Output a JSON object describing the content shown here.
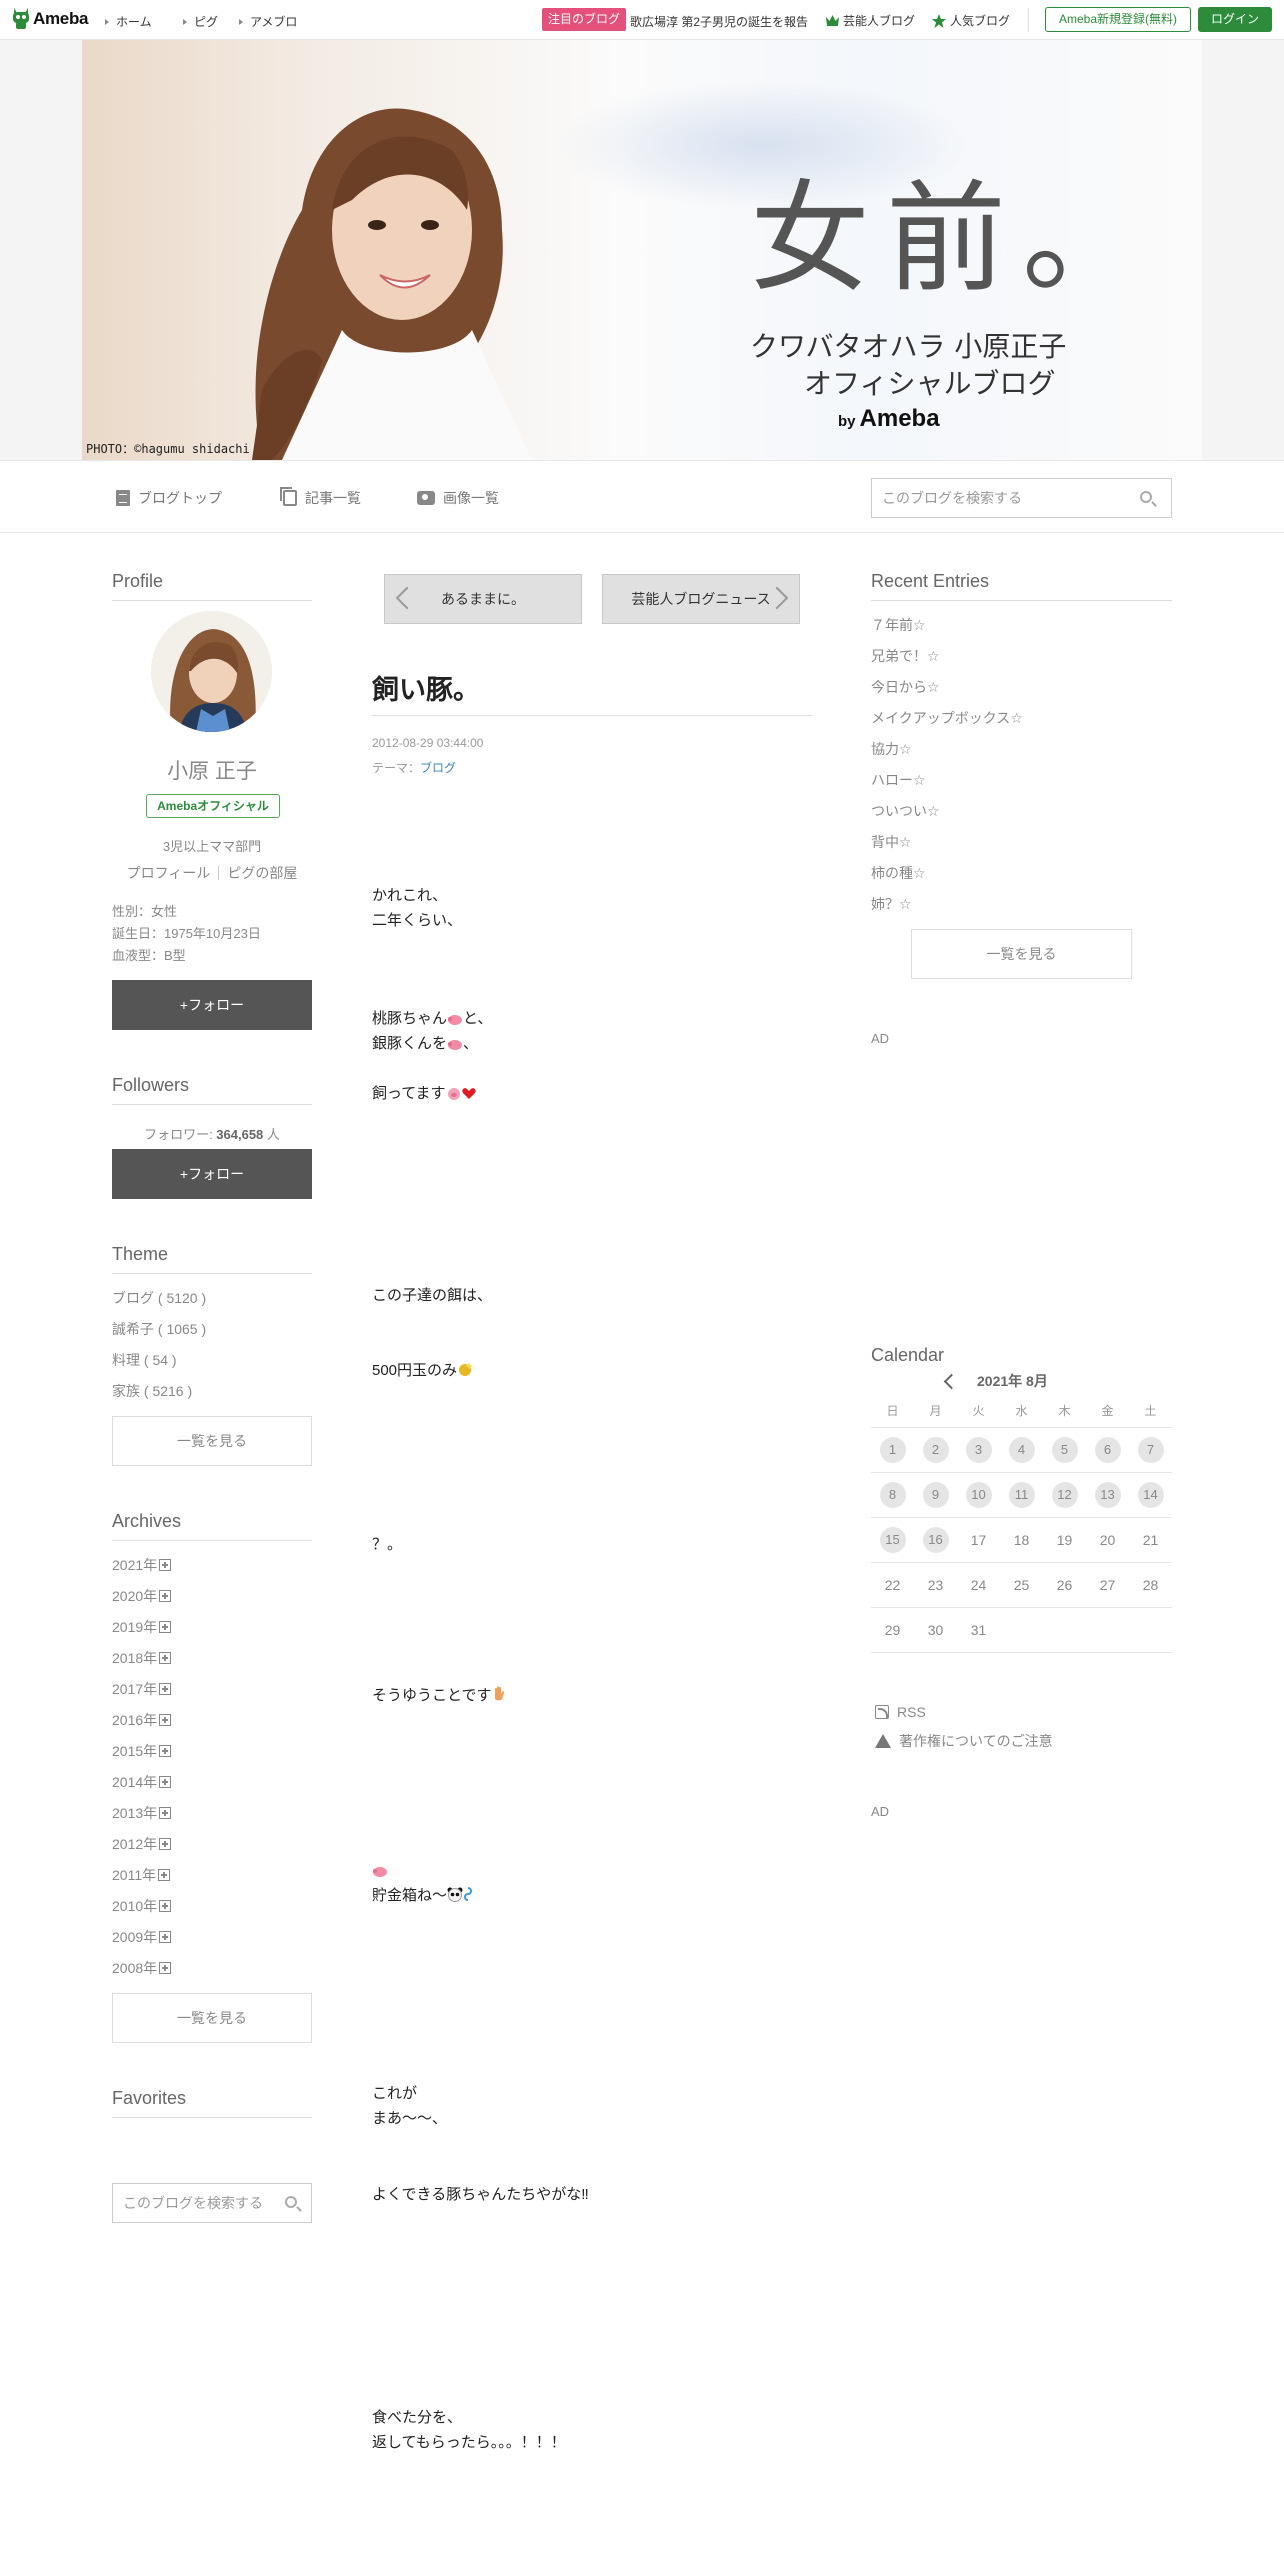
{
  "global_nav": {
    "logo_text": "Ameba",
    "links": [
      "ホーム",
      "ピグ",
      "アメブロ"
    ],
    "pickup_badge": "注目のブログ",
    "pickup_text": "歌広場淳 第2子男児の誕生を報告",
    "rank_links": [
      "芸能人ブログ",
      "人気ブログ"
    ],
    "register_label": "Ameba新規登録(無料)",
    "login_label": "ログイン"
  },
  "banner": {
    "title": "女前。",
    "subtitle_1": "クワバタオハラ 小原正子",
    "subtitle_2": "オフィシャルブログ",
    "by_prefix": "by",
    "by_brand": "Ameba",
    "credit": "PHOTO：©hagumu shidachi"
  },
  "blog_nav": {
    "items": [
      "ブログトップ",
      "記事一覧",
      "画像一覧"
    ],
    "search_placeholder": "このブログを検索する"
  },
  "profile": {
    "heading": "Profile",
    "name": "小原 正子",
    "badge": "Amebaオフィシャル",
    "tagline": "3児以上ママ部門",
    "link_profile": "プロフィール",
    "link_pigg": "ピグの部屋",
    "gender": "性別：女性",
    "birthday": "誕生日：1975年10月23日",
    "blood_type": "血液型：B型",
    "follow_label": "+フォロー"
  },
  "followers": {
    "heading": "Followers",
    "label": "フォロワー: ",
    "count": "364,658",
    "unit": " 人",
    "follow_label": "+フォロー"
  },
  "theme": {
    "heading": "Theme",
    "items": [
      "ブログ ( 5120 )",
      "誠希子 ( 1065 )",
      "料理 ( 54 )",
      "家族 ( 5216 )"
    ],
    "more_label": "一覧を見る"
  },
  "archives": {
    "heading": "Archives",
    "years": [
      "2021年",
      "2020年",
      "2019年",
      "2018年",
      "2017年",
      "2016年",
      "2015年",
      "2014年",
      "2013年",
      "2012年",
      "2011年",
      "2010年",
      "2009年",
      "2008年"
    ],
    "more_label": "一覧を見る"
  },
  "favorites": {
    "heading": "Favorites",
    "search_placeholder": "このブログを検索する"
  },
  "pager": {
    "prev": "あるままに。",
    "next": "芸能人ブログニュース"
  },
  "post": {
    "title": "飼い豚。",
    "date": "2012-08-29 03:44:00",
    "theme_label": "テーマ：",
    "theme_value": "ブログ",
    "p1": "かれこれ、\n二年くらい、",
    "p2a": "桃豚ちゃん",
    "p2b": "と、",
    "p2c": "銀豚くんを",
    "p2d": "、",
    "p3": "飼ってます",
    "p4": "この子達の餌は、",
    "p5": "500円玉のみ",
    "p6": "？。",
    "p7": "そうゆうことです",
    "p8": "貯金箱ね～",
    "p9": "これが\nまあ～～、",
    "p10": "よくできる豚ちゃんたちやがな‼",
    "p11": "食べた分を、\n返してもらったら。。。！！！"
  },
  "recent": {
    "heading": "Recent Entries",
    "items": [
      "７年前☆",
      "兄弟で！☆",
      "今日から☆",
      "メイクアップボックス☆",
      "協力☆",
      "ハロー☆",
      "ついつい☆",
      "背中☆",
      "柿の種☆",
      "姉？☆"
    ],
    "more_label": "一覧を見る"
  },
  "ad_label": "AD",
  "calendar": {
    "heading": "Calendar",
    "title": "2021年 8月",
    "weekdays": [
      "日",
      "月",
      "火",
      "水",
      "木",
      "金",
      "土"
    ],
    "weeks": [
      [
        "1",
        "2",
        "3",
        "4",
        "5",
        "6",
        "7"
      ],
      [
        "8",
        "9",
        "10",
        "11",
        "12",
        "13",
        "14"
      ],
      [
        "15",
        "16",
        "17",
        "18",
        "19",
        "20",
        "21"
      ],
      [
        "22",
        "23",
        "24",
        "25",
        "26",
        "27",
        "28"
      ],
      [
        "29",
        "30",
        "31",
        "",
        "",
        "",
        ""
      ]
    ],
    "highlighted_through": 16
  },
  "footer_links": {
    "rss": "RSS",
    "copyright": "著作権についてのご注意"
  },
  "colors": {
    "ameba_green": "#2d8c3c",
    "pickup_pink": "#e5507a",
    "follow_button": "#555555",
    "theme_link": "#3b86b5"
  }
}
